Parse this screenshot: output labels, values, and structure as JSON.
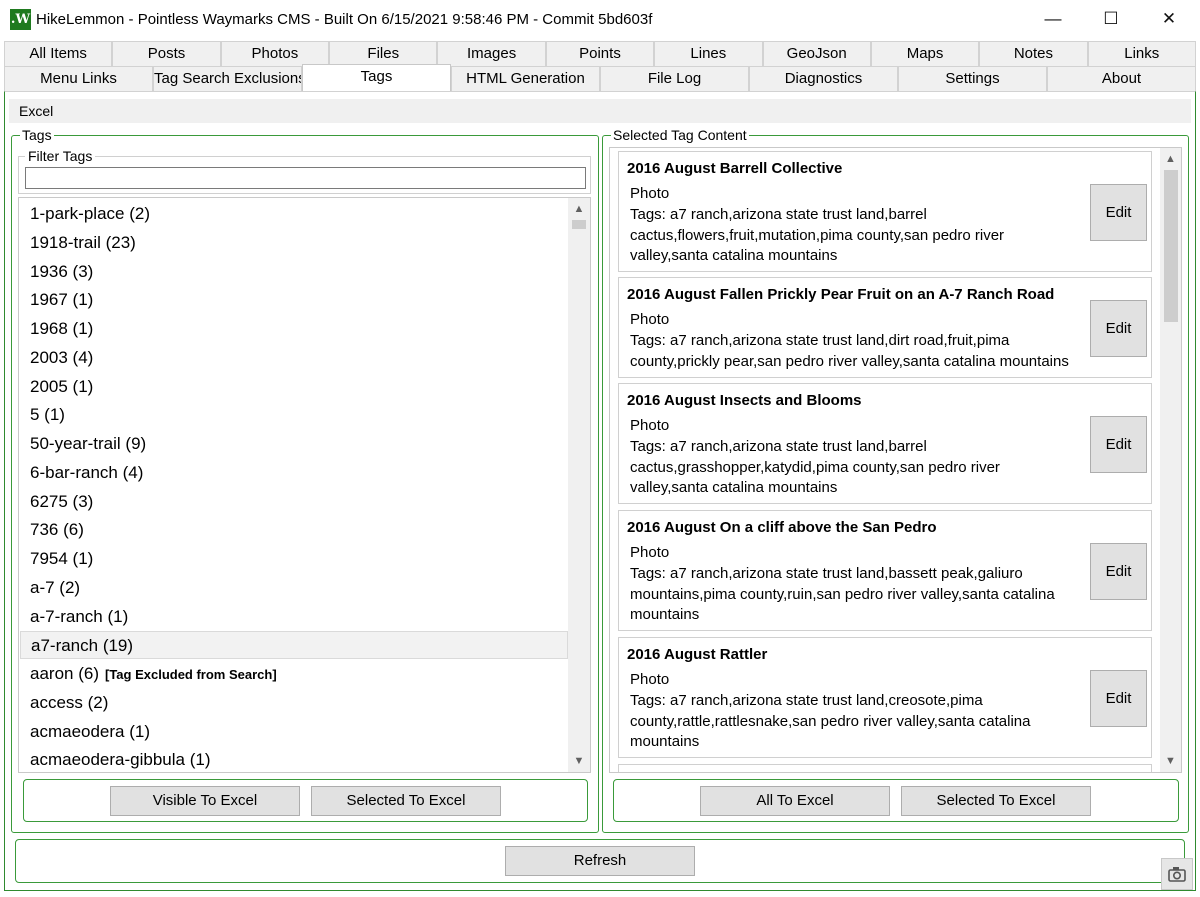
{
  "window": {
    "title": "HikeLemmon - Pointless Waymarks CMS - Built On 6/15/2021 9:58:46 PM - Commit 5bd603f",
    "icon_glyph": ".W",
    "controls": {
      "minimize": "—",
      "maximize": "☐",
      "close": "✕"
    }
  },
  "tabs": {
    "row1": [
      "All Items",
      "Posts",
      "Photos",
      "Files",
      "Images",
      "Points",
      "Lines",
      "GeoJson",
      "Maps",
      "Notes",
      "Links"
    ],
    "row2": [
      "Menu Links",
      "Tag Search Exclusions",
      "Tags",
      "HTML Generation",
      "File Log",
      "Diagnostics",
      "Settings",
      "About"
    ],
    "active": "Tags"
  },
  "menu": {
    "excel": "Excel"
  },
  "tags_panel": {
    "title": "Tags",
    "filter_label": "Filter Tags",
    "filter_value": "",
    "excluded_note": "[Tag Excluded from Search]",
    "items": [
      {
        "label": "1-park-place (2)",
        "selected": false,
        "excluded": false
      },
      {
        "label": "1918-trail (23)",
        "selected": false,
        "excluded": false
      },
      {
        "label": "1936 (3)",
        "selected": false,
        "excluded": false
      },
      {
        "label": "1967 (1)",
        "selected": false,
        "excluded": false
      },
      {
        "label": "1968 (1)",
        "selected": false,
        "excluded": false
      },
      {
        "label": "2003 (4)",
        "selected": false,
        "excluded": false
      },
      {
        "label": "2005 (1)",
        "selected": false,
        "excluded": false
      },
      {
        "label": "5 (1)",
        "selected": false,
        "excluded": false
      },
      {
        "label": "50-year-trail (9)",
        "selected": false,
        "excluded": false
      },
      {
        "label": "6-bar-ranch (4)",
        "selected": false,
        "excluded": false
      },
      {
        "label": "6275 (3)",
        "selected": false,
        "excluded": false
      },
      {
        "label": "736 (6)",
        "selected": false,
        "excluded": false
      },
      {
        "label": "7954 (1)",
        "selected": false,
        "excluded": false
      },
      {
        "label": "a-7 (2)",
        "selected": false,
        "excluded": false
      },
      {
        "label": "a-7-ranch (1)",
        "selected": false,
        "excluded": false
      },
      {
        "label": "a7-ranch (19)",
        "selected": true,
        "excluded": false
      },
      {
        "label": "aaron (6)",
        "selected": false,
        "excluded": true
      },
      {
        "label": "access (2)",
        "selected": false,
        "excluded": false
      },
      {
        "label": "acmaeodera (1)",
        "selected": false,
        "excluded": false
      },
      {
        "label": "acmaeodera-gibbula (1)",
        "selected": false,
        "excluded": false
      }
    ],
    "buttons": {
      "visible_to_excel": "Visible To Excel",
      "selected_to_excel": "Selected To Excel"
    }
  },
  "content_panel": {
    "title": "Selected Tag Content",
    "edit_label": "Edit",
    "cards": [
      {
        "title": "2016 August Barrell Collective",
        "type": "Photo",
        "tags": "Tags: a7 ranch,arizona state trust land,barrel cactus,flowers,fruit,mutation,pima county,san pedro river valley,santa catalina mountains"
      },
      {
        "title": "2016 August Fallen Prickly Pear Fruit on an A-7 Ranch Road",
        "type": "Photo",
        "tags": "Tags: a7 ranch,arizona state trust land,dirt road,fruit,pima county,prickly pear,san pedro river valley,santa catalina mountains"
      },
      {
        "title": "2016 August Insects and Blooms",
        "type": "Photo",
        "tags": "Tags: a7 ranch,arizona state trust land,barrel cactus,grasshopper,katydid,pima county,san pedro river valley,santa catalina mountains"
      },
      {
        "title": "2016 August On a cliff above the San Pedro",
        "type": "Photo",
        "tags": "Tags: a7 ranch,arizona state trust land,bassett peak,galiuro mountains,pima county,ruin,san pedro river valley,santa catalina mountains"
      },
      {
        "title": "2016 August Rattler",
        "type": "Photo",
        "tags": "Tags: a7 ranch,arizona state trust land,creosote,pima county,rattle,rattlesnake,san pedro river valley,santa catalina mountains"
      }
    ],
    "buttons": {
      "all_to_excel": "All To Excel",
      "selected_to_excel": "Selected To Excel"
    }
  },
  "footer": {
    "refresh": "Refresh"
  },
  "colors": {
    "group_border": "#3a9a3a",
    "button_face": "#e1e1e1",
    "tab_face": "#f0f0f0",
    "app_icon": "#1f7a1f"
  }
}
